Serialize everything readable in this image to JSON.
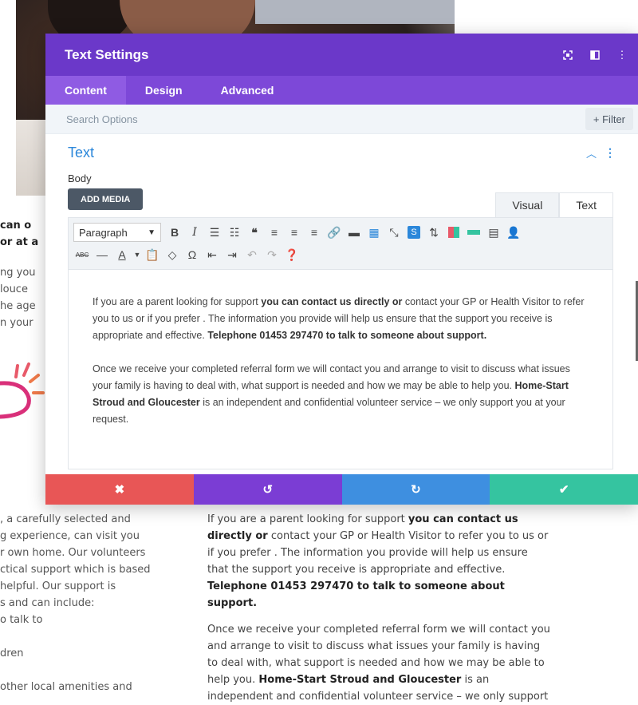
{
  "modal": {
    "title": "Text Settings",
    "header_icons": [
      "expand-icon",
      "split-view-icon",
      "more-vertical-icon"
    ],
    "tabs": [
      {
        "label": "Content",
        "active": true
      },
      {
        "label": "Design",
        "active": false
      },
      {
        "label": "Advanced",
        "active": false
      }
    ],
    "search": {
      "placeholder": "Search Options",
      "filter_label": "+ Filter"
    },
    "section": {
      "title": "Text",
      "expanded": true
    },
    "body_label": "Body",
    "add_media_label": "ADD MEDIA",
    "mode_tabs": [
      {
        "label": "Visual",
        "active": false
      },
      {
        "label": "Text",
        "active": true
      }
    ],
    "toolbar": {
      "format_select": "Paragraph",
      "row1_icons": [
        "bold-icon",
        "italic-icon",
        "bullet-list-icon",
        "numbered-list-icon",
        "blockquote-icon",
        "align-left-icon",
        "align-center-icon",
        "align-right-icon",
        "link-icon",
        "horizontal-rule-icon",
        "keyboard-icon",
        "fullscreen-icon",
        "plugin-s-icon",
        "upload-icon",
        "palette-icon",
        "highlight-icon",
        "table-icon",
        "user-icon"
      ],
      "row2_icons": [
        "strikethrough-icon",
        "hr-icon",
        "text-color-icon",
        "paste-icon",
        "eraser-icon",
        "omega-icon",
        "outdent-icon",
        "indent-icon",
        "undo-icon",
        "redo-icon",
        "help-icon"
      ]
    },
    "editor_paragraphs": [
      {
        "t1": "If you are a parent looking for support ",
        "b1": "you can contact us directly or",
        "t2": " contact your GP or Health Visitor to refer you to us or if you prefer . The information you provide will help us ensure that the support you receive is appropriate and effective. ",
        "b2": "Telephone 01453 297470 to talk to someone about support."
      },
      {
        "t1": "Once we receive your completed referral form we will contact you and arrange to visit to discuss what issues your family is having to deal with, what support is needed and how we may be able to help you. ",
        "b1": "Home-Start Stroud and Gloucester",
        "t2": " is an independent and confidential volunteer service – we only support you at your request."
      }
    ],
    "actions": [
      "discard-icon",
      "undo-icon",
      "redo-icon",
      "save-icon"
    ]
  },
  "background": {
    "left_top": [
      "can o",
      "or at a"
    ],
    "left_mid": [
      "ng you",
      "louce",
      "he age",
      "n your"
    ],
    "left_bottom": [
      ", a carefully selected and",
      "g experience, can visit you",
      "r own home. Our volunteers",
      "ctical support which is based",
      " helpful. Our support is",
      "s and can include:",
      "o talk to",
      "",
      "dren",
      "",
      "other local amenities and"
    ],
    "right_paragraphs": [
      {
        "t1": "If you are a parent looking for support ",
        "b1": "you can contact us directly or",
        "t2": " contact your GP or Health Visitor to refer you to us or if you prefer . The information you provide will help us ensure that the support you receive is appropriate and effective. ",
        "b2": "Telephone 01453 297470 to talk to someone about support."
      },
      {
        "t1": "Once we receive your completed referral form we will contact you and arrange to visit to discuss what issues your family is having to deal with, what support is needed and how we may be able to help you. ",
        "b1": "Home-Start Stroud and Gloucester",
        "t2": " is an independent and confidential volunteer service – we only support you at your request."
      }
    ]
  },
  "colors": {
    "header": "#6b38c9",
    "tabs": "#7d48d8",
    "accent_blue": "#2b87da",
    "discard": "#e85656",
    "undo": "#7b3dd4",
    "redo": "#3e8fe0",
    "save": "#35c4a0"
  }
}
